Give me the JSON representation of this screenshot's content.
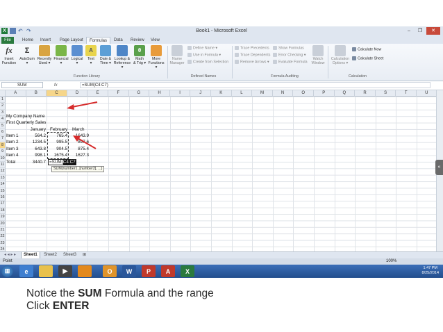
{
  "window": {
    "title": "Book1 - Microsoft Excel",
    "buttons": [
      "–",
      "❐",
      "✕"
    ]
  },
  "tabs": [
    "File",
    "Home",
    "Insert",
    "Page Layout",
    "Formulas",
    "Data",
    "Review",
    "View"
  ],
  "active_tab": "Formulas",
  "ribbon": {
    "function_library": {
      "label": "Function Library",
      "buttons": [
        {
          "label": "Insert\nFunction",
          "icon": "fx-icon"
        },
        {
          "label": "AutoSum\n▾",
          "icon": "sigma-icon"
        },
        {
          "label": "Recently\nUsed ▾",
          "icon": "book-icon"
        },
        {
          "label": "Financial\n▾",
          "icon": "book-icon"
        },
        {
          "label": "Logical\n▾",
          "icon": "book-icon"
        },
        {
          "label": "Text\n▾",
          "icon": "book-icon"
        },
        {
          "label": "Date &\nTime ▾",
          "icon": "book-icon"
        },
        {
          "label": "Lookup &\nReference ▾",
          "icon": "book-icon"
        },
        {
          "label": "Math\n& Trig ▾",
          "icon": "book-icon"
        },
        {
          "label": "More\nFunctions ▾",
          "icon": "book-icon"
        }
      ]
    },
    "defined_names": {
      "label": "Defined Names",
      "name_manager": "Name\nManager",
      "items": [
        "Define Name ▾",
        "Use in Formula ▾",
        "Create from Selection"
      ]
    },
    "formula_auditing": {
      "label": "Formula Auditing",
      "items": [
        "Trace Precedents",
        "Trace Dependents",
        "Remove Arrows ▾",
        "Show Formulas",
        "Error Checking ▾",
        "Evaluate Formula"
      ],
      "watch_window": "Watch\nWindow"
    },
    "calculation": {
      "label": "Calculation",
      "options": "Calculation\nOptions ▾",
      "calc_now": "Calculate Now",
      "calc_sheet": "Calculate Sheet"
    }
  },
  "formula_bar": {
    "name_box": "SUM",
    "fx": "fx",
    "formula": "=SUM(C4:C7)"
  },
  "columns": [
    "A",
    "B",
    "C",
    "D",
    "E",
    "F",
    "G",
    "H",
    "I",
    "J",
    "K",
    "L",
    "M",
    "N",
    "O",
    "P",
    "Q",
    "R",
    "S",
    "T",
    "U"
  ],
  "rows": [
    "1",
    "2",
    "3",
    "4",
    "5",
    "6",
    "7",
    "8",
    "9",
    "10",
    "11",
    "12",
    "13",
    "14",
    "15",
    "16",
    "17",
    "18",
    "19",
    "20",
    "21",
    "22",
    "23",
    "24"
  ],
  "cells": {
    "A1": "My Company Name",
    "A2": "First Quarterly Sales",
    "B3": "January",
    "C3": "February",
    "D3": "March",
    "A4": "Item 1",
    "B4": "564.2",
    "C4": "765.4",
    "D4": "1643.9",
    "A5": "Item 2",
    "B5": "1234.5",
    "C5": "995.5",
    "D5": "897.6",
    "A6": "Item 3",
    "B6": "643.8",
    "C6": "904.5",
    "D6": "875.4",
    "A7": "Item 4",
    "B7": "998.1",
    "C7": "1675.4",
    "D7": "1627.3",
    "A8": "Total",
    "B8": "3440.7"
  },
  "active_cell": {
    "prefix": "=SUM(",
    "range": "C4:C7",
    "tooltip": "SUM(number1, [number2], ...)"
  },
  "sheets": [
    "Sheet1",
    "Sheet2",
    "Sheet3"
  ],
  "active_sheet": "Sheet1",
  "status": {
    "mode": "Point",
    "zoom": "100%"
  },
  "taskbar": {
    "time": "1:47 PM",
    "date": "8/25/2014"
  },
  "caption": {
    "line1_pre": "Notice the ",
    "line1_bold": "SUM",
    "line1_post": " Formula and the range",
    "line2_pre": "Click ",
    "line2_bold": "ENTER"
  },
  "colors": {
    "accent": "#2a7a3e",
    "arrow": "#d62b2b",
    "selected_header": "#f6d68a"
  }
}
